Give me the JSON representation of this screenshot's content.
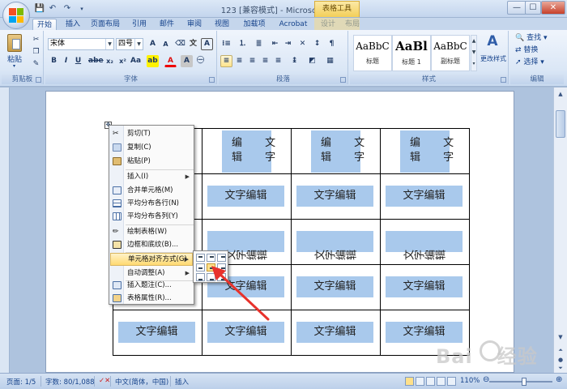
{
  "window": {
    "title": "123 [兼容模式] - Microsoft Word",
    "context_tab_title": "表格工具",
    "buttons": {
      "minimize": "—",
      "maximize": "☐",
      "close": "✕"
    }
  },
  "quick_access": {
    "save": "💾",
    "undo": "↶",
    "redo": "↷"
  },
  "tabs": [
    "开始",
    "插入",
    "页面布局",
    "引用",
    "邮件",
    "审阅",
    "视图",
    "加载项",
    "Acrobat",
    "设计",
    "布局"
  ],
  "ribbon": {
    "clipboard": {
      "label": "剪贴板",
      "paste": "粘贴"
    },
    "font": {
      "label": "字体",
      "family": "宋体",
      "size": "四号"
    },
    "paragraph": {
      "label": "段落"
    },
    "styles": {
      "label": "样式",
      "items": [
        {
          "sample": "AaBbC",
          "name": "标题"
        },
        {
          "sample": "AaBl",
          "name": "标题 1"
        },
        {
          "sample": "AaBbC",
          "name": "副标题"
        }
      ],
      "change_styles": "更改样式"
    },
    "editing": {
      "label": "编辑",
      "find": "查找",
      "replace": "替换",
      "select": "选择"
    }
  },
  "document": {
    "cell_text": "文字编辑",
    "stacked_rows": [
      "编 文",
      "辑 字"
    ]
  },
  "context_menu": {
    "items": [
      {
        "label": "剪切(T)"
      },
      {
        "label": "复制(C)"
      },
      {
        "label": "粘贴(P)"
      },
      {
        "label": "插入(I)"
      },
      {
        "label": "合并单元格(M)"
      },
      {
        "label": "平均分布各行(N)"
      },
      {
        "label": "平均分布各列(Y)"
      },
      {
        "label": "绘制表格(W)"
      },
      {
        "label": "边框和底纹(B)..."
      },
      {
        "label": "单元格对齐方式(G)"
      },
      {
        "label": "自动调整(A)"
      },
      {
        "label": "插入题注(C)..."
      },
      {
        "label": "表格属性(R)..."
      }
    ],
    "highlighted": "单元格对齐方式(G)"
  },
  "status_bar": {
    "page": "页面: 1/5",
    "words": "字数: 80/1,088",
    "language": "中文(简体，中国)",
    "mode": "插入",
    "zoom": "110%",
    "zoom_level": 0.55
  },
  "watermark": {
    "text": "Bai",
    "text2": "经验"
  },
  "colors": {
    "cell_shading": "#a9c9ec",
    "arrow": "#e8322c",
    "menu_highlight": "#ffd971"
  },
  "icons": [
    "office-button-icon",
    "save-icon",
    "undo-icon",
    "redo-icon",
    "cut-icon",
    "copy-icon",
    "paste-icon"
  ]
}
